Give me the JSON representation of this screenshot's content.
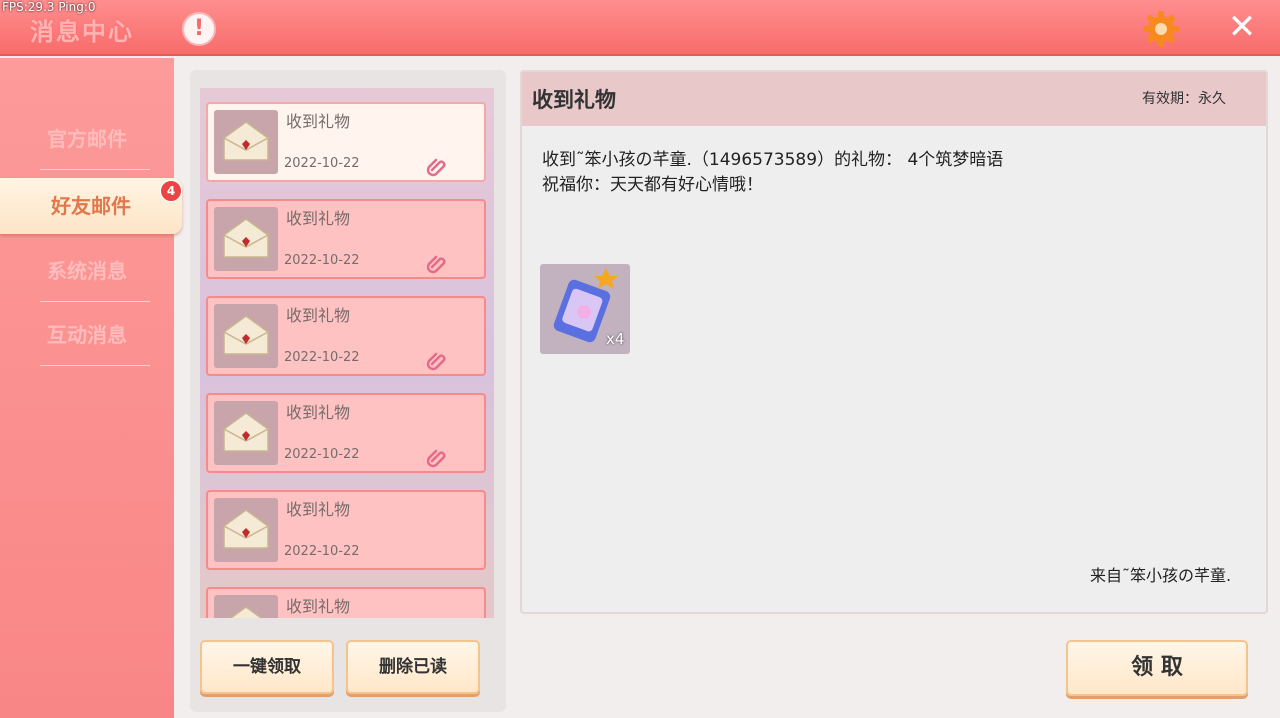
{
  "overlay": {
    "fps_text": "FPS:29.3  Ping:0"
  },
  "header": {
    "title": "消息中心",
    "alert_glyph": "!",
    "close_glyph": "✕"
  },
  "sidebar": {
    "items": [
      {
        "label": "官方邮件",
        "active": false
      },
      {
        "label": "好友邮件",
        "active": true,
        "badge": "4"
      },
      {
        "label": "系统消息",
        "active": false
      },
      {
        "label": "互动消息",
        "active": false
      }
    ]
  },
  "mail_list": {
    "items": [
      {
        "title": "收到礼物",
        "date": "2022-10-22",
        "selected": true
      },
      {
        "title": "收到礼物",
        "date": "2022-10-22",
        "selected": false
      },
      {
        "title": "收到礼物",
        "date": "2022-10-22",
        "selected": false
      },
      {
        "title": "收到礼物",
        "date": "2022-10-22",
        "selected": false
      },
      {
        "title": "收到礼物",
        "date": "2022-10-22",
        "selected": false
      },
      {
        "title": "收到礼物",
        "date": "",
        "selected": false
      }
    ],
    "claim_all_label": "一键领取",
    "delete_read_label": "删除已读"
  },
  "detail": {
    "title": "收到礼物",
    "validity": "有效期：永久",
    "body_line1": "收到˜笨小孩の芊童.（1496573589）的礼物： 4个筑梦暗语",
    "body_line2": "祝福你：天天都有好心情哦！",
    "attachment_count": "x4",
    "sender": "来自˜笨小孩の芊童.",
    "claim_label": "领 取"
  },
  "colors": {
    "accent": "#f86c6c",
    "active_tab": "#e3774c",
    "badge": "#e94545"
  },
  "icons": [
    "alert-icon",
    "gear-icon",
    "close-icon",
    "envelope-icon",
    "attachment-icon",
    "gift-item-icon"
  ]
}
